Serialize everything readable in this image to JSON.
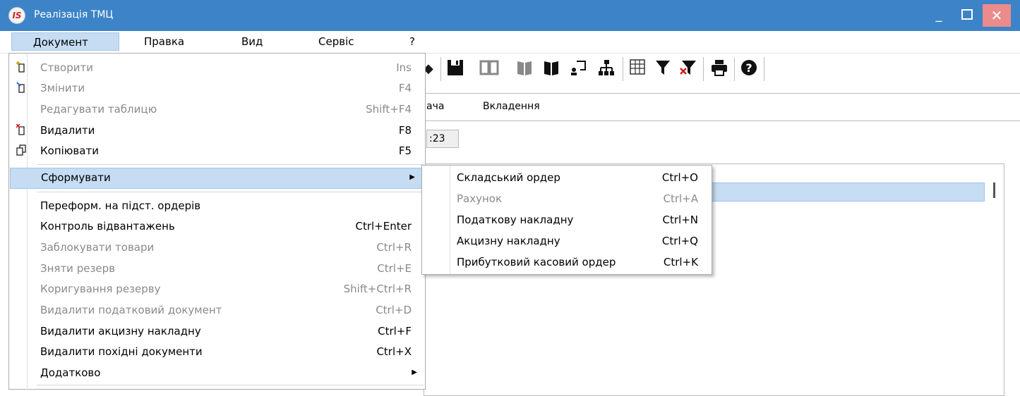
{
  "window": {
    "title": "Реалізація ТМЦ",
    "icon": "is-app-icon",
    "min": "_",
    "close": "✕"
  },
  "menubar": [
    "Документ",
    "Правка",
    "Вид",
    "Сервіс",
    "?"
  ],
  "tabs": {
    "tab1_partial": "ача",
    "tab2": "Вкладення"
  },
  "field_value_partial": ":23",
  "menu": {
    "create": {
      "label": "Створити",
      "shortcut": "Ins",
      "icon": "new-doc-icon"
    },
    "edit": {
      "label": "Змінити",
      "shortcut": "F4",
      "icon": "edit-doc-icon"
    },
    "edit_table": {
      "label": "Редагувати таблицю",
      "shortcut": "Shift+F4"
    },
    "delete": {
      "label": "Видалити",
      "shortcut": "F8",
      "icon": "delete-doc-icon"
    },
    "copy": {
      "label": "Копіювати",
      "shortcut": "F5",
      "icon": "copy-icon"
    },
    "generate": {
      "label": "Сформувати"
    },
    "reform": {
      "label": "Переформ. на підст. ордерів"
    },
    "shipment_control": {
      "label": "Контроль відвантажень",
      "shortcut": "Ctrl+Enter"
    },
    "block_goods": {
      "label": "Заблокувати товари",
      "shortcut": "Ctrl+R"
    },
    "remove_reserve": {
      "label": "Зняти резерв",
      "shortcut": "Ctrl+E"
    },
    "adjust_reserve": {
      "label": "Коригування резерву",
      "shortcut": "Shift+Ctrl+R"
    },
    "delete_tax_doc": {
      "label": "Видалити податковий документ",
      "shortcut": "Ctrl+D"
    },
    "delete_excise": {
      "label": "Видалити акцизну накладну",
      "shortcut": "Ctrl+F"
    },
    "delete_derived": {
      "label": "Видалити похідні документи",
      "shortcut": "Ctrl+X"
    },
    "additional": {
      "label": "Додатково"
    }
  },
  "submenu": {
    "warehouse_order": {
      "label": "Складський ордер",
      "shortcut": "Ctrl+O"
    },
    "invoice": {
      "label": "Рахунок",
      "shortcut": "Ctrl+A"
    },
    "tax_invoice": {
      "label": "Податкову накладну",
      "shortcut": "Ctrl+N"
    },
    "excise_invoice": {
      "label": "Акцизну накладну",
      "shortcut": "Ctrl+Q"
    },
    "cash_receipt": {
      "label": "Прибутковий касовий ордер",
      "shortcut": "Ctrl+K"
    }
  },
  "toolbar": [
    "arrow-icon",
    "save-icon",
    "book-open-icon",
    "book-closed-icon",
    "folder-icon",
    "user-doc-icon",
    "hierarchy-icon",
    "grid-icon",
    "filter-icon",
    "clear-filter-icon",
    "print-icon",
    "help-icon"
  ],
  "colors": {
    "titlebar": "#3d83c7",
    "highlight": "#c5dcf3",
    "close": "#ec8b8b",
    "disabled": "#8a8a8a"
  }
}
